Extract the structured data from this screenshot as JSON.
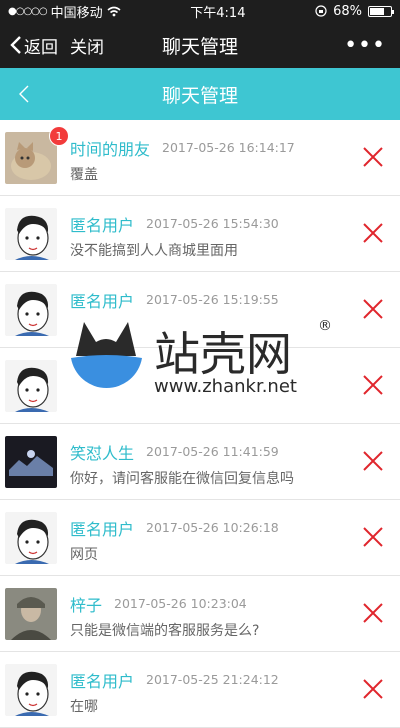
{
  "status": {
    "carrier": "中国移动",
    "time": "下午4:14",
    "battery": "68%",
    "battery_level": 0.68
  },
  "nav": {
    "back_label": "返回",
    "close_label": "关闭",
    "title": "聊天管理",
    "more": "•••"
  },
  "subheader": {
    "title": "聊天管理"
  },
  "unread_badge": "1",
  "items": [
    {
      "name": "时间的朋友",
      "time": "2017-05-26 16:14:17",
      "message": "覆盖",
      "avatar": "cat"
    },
    {
      "name": "匿名用户",
      "time": "2017-05-26 15:54:30",
      "message": "没不能搞到人人商城里面用",
      "avatar": "cartoon"
    },
    {
      "name": "匿名用户",
      "time": "2017-05-26 15:19:55",
      "message": "",
      "avatar": "cartoon"
    },
    {
      "name": "",
      "time": "",
      "message": "",
      "avatar": "cartoon"
    },
    {
      "name": "笑怼人生",
      "time": "2017-05-26 11:41:59",
      "message": "你好，请问客服能在微信回复信息吗",
      "avatar": "photo"
    },
    {
      "name": "匿名用户",
      "time": "2017-05-26 10:26:18",
      "message": "网页",
      "avatar": "cartoon"
    },
    {
      "name": "梓子",
      "time": "2017-05-26 10:23:04",
      "message": "只能是微信端的客服服务是么?",
      "avatar": "soldier"
    },
    {
      "name": "匿名用户",
      "time": "2017-05-25 21:24:12",
      "message": "在哪",
      "avatar": "cartoon"
    }
  ],
  "watermark": {
    "brand": "站壳网",
    "url": "www.zhankr.net",
    "registered": "®"
  },
  "colors": {
    "accent": "#3ec6d2",
    "delete": "#e0262d",
    "badge": "#f23b3b"
  }
}
